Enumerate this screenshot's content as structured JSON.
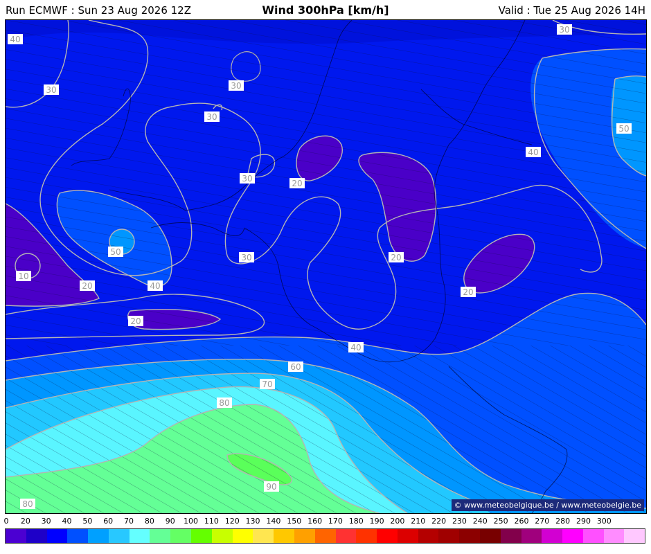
{
  "header": {
    "run": "Run ECMWF : Sun 23 Aug 2026 12Z",
    "title": "Wind 300hPa [km/h]",
    "valid": "Valid : Tue 25 Aug 2026 14H"
  },
  "copyright": "© www.meteobelgique.be / www.meteobelgie.be",
  "contour_labels": [
    "40",
    "30",
    "30",
    "30",
    "30",
    "20",
    "50",
    "10",
    "20",
    "40",
    "20",
    "30",
    "20",
    "20",
    "40",
    "50",
    "30",
    "40",
    "60",
    "70",
    "80",
    "90",
    "80"
  ],
  "colorbar": {
    "tick_labels": [
      "0",
      "20",
      "30",
      "40",
      "50",
      "60",
      "70",
      "80",
      "90",
      "100",
      "110",
      "120",
      "130",
      "140",
      "150",
      "160",
      "170",
      "180",
      "190",
      "200",
      "210",
      "220",
      "230",
      "240",
      "250",
      "260",
      "270",
      "280",
      "290",
      "300"
    ],
    "colors": [
      "#4b00d2",
      "#1e00c8",
      "#0000ff",
      "#0050ff",
      "#00a0ff",
      "#28c8ff",
      "#64ffff",
      "#64ff96",
      "#64ff64",
      "#64ff00",
      "#c8ff00",
      "#ffff00",
      "#ffe650",
      "#ffc800",
      "#ffa000",
      "#ff6400",
      "#ff3232",
      "#ff3200",
      "#ff0000",
      "#dc0000",
      "#b40000",
      "#a00000",
      "#8c0000",
      "#780000",
      "#82004b",
      "#a0007d",
      "#d200d2",
      "#ff00ff",
      "#ff50ff",
      "#ff8cff",
      "#ffc8ff"
    ]
  },
  "legend_colors": {
    "c10": "#4a00c8",
    "c20": "#2a00dc",
    "c30": "#0018ee",
    "c40": "#003cff",
    "c50": "#0096ff",
    "c60": "#22c8ff",
    "c70": "#5af5ff",
    "c80": "#64ff96",
    "c90": "#5aff5a"
  }
}
